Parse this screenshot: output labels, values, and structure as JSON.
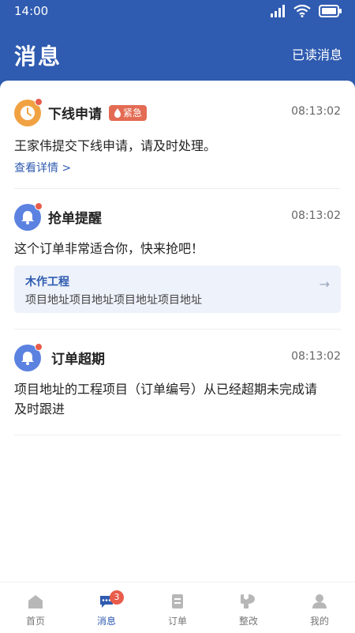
{
  "status": {
    "time": "14:00"
  },
  "header": {
    "title": "消息",
    "read_action": "已读消息"
  },
  "messages": [
    {
      "title": "下线申请",
      "badge": "紧急",
      "time": "08:13:02",
      "body": "王家伟提交下线申请，请及时处理。",
      "link": "查看详情 >"
    },
    {
      "title": "抢单提醒",
      "time": "08:13:02",
      "body": "这个订单非常适合你，快来抢吧！",
      "card": {
        "title": "木作工程",
        "address": "项目地址项目地址项目地址项目地址"
      }
    },
    {
      "title": "订单超期",
      "time": "08:13:02",
      "body_line1": "项目地址的工程项目（订单编号）从已经超期未完成请",
      "body_line2": "及时跟进"
    }
  ],
  "tabbar": {
    "items": [
      {
        "label": "首页",
        "icon": "home-icon"
      },
      {
        "label": "消息",
        "icon": "message-icon",
        "badge": "3",
        "active": true
      },
      {
        "label": "订单",
        "icon": "order-icon"
      },
      {
        "label": "整改",
        "icon": "wrench-icon"
      },
      {
        "label": "我的",
        "icon": "user-icon"
      }
    ]
  },
  "colors": {
    "brand": "#2f5bb0",
    "urgent": "#e36b53",
    "clock_icon_bg": "#f0a243",
    "bell_icon_bg": "#5b82e0"
  }
}
